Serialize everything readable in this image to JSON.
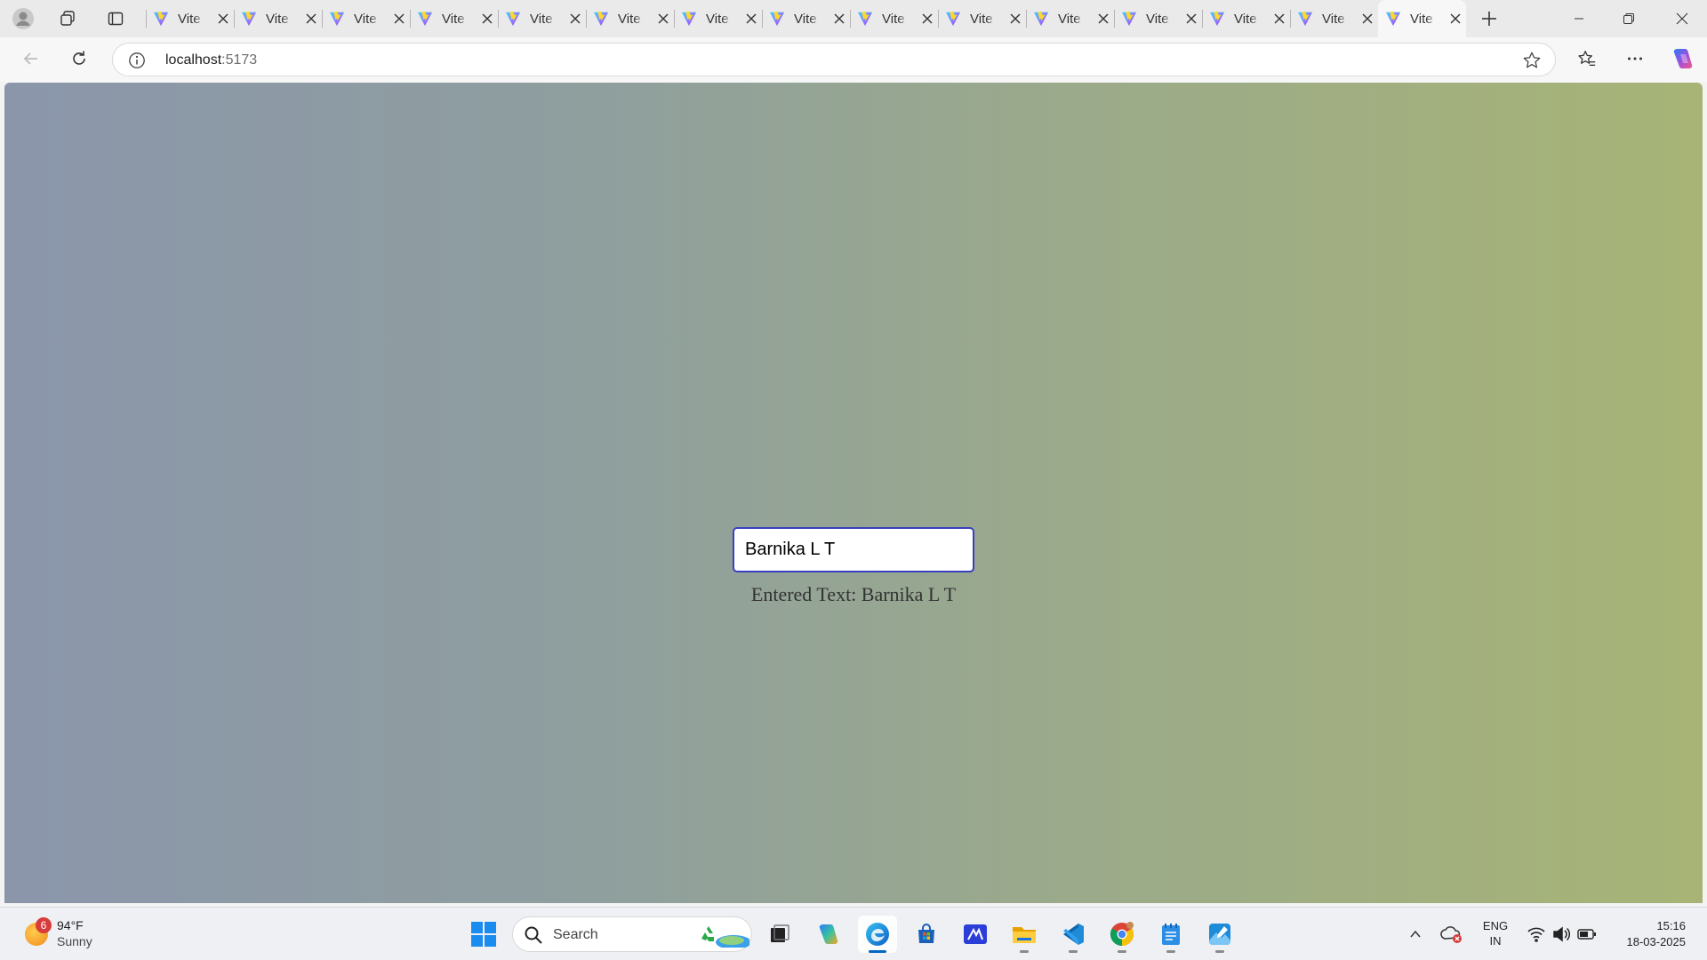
{
  "browser": {
    "tabs": [
      {
        "title": "Vite"
      },
      {
        "title": "Vite"
      },
      {
        "title": "Vite"
      },
      {
        "title": "Vite"
      },
      {
        "title": "Vite"
      },
      {
        "title": "Vite"
      },
      {
        "title": "Vite"
      },
      {
        "title": "Vite"
      },
      {
        "title": "Vite"
      },
      {
        "title": "Vite"
      },
      {
        "title": "Vite"
      },
      {
        "title": "Vite"
      },
      {
        "title": "Vite"
      },
      {
        "title": "Vite"
      },
      {
        "title": "Vite",
        "active": true
      }
    ],
    "address": {
      "host": "localhost",
      "port": ":5173"
    },
    "accent_color": "#0067c0"
  },
  "page": {
    "input_value": "Barnika L T",
    "output_text": "Entered Text: Barnika L T",
    "input_border_color": "#3a3fbf"
  },
  "taskbar": {
    "weather": {
      "badge": "6",
      "temp": "94°F",
      "desc": "Sunny"
    },
    "search_placeholder": "Search",
    "apps": [
      "windows-start-icon",
      "task-view-icon",
      "copilot-icon",
      "edge-icon",
      "store-icon",
      "whiteboard-icon",
      "file-explorer-icon",
      "vscode-icon",
      "chrome-icon",
      "notepad-icon",
      "photos-icon"
    ],
    "lang": {
      "line1": "ENG",
      "line2": "IN"
    },
    "clock": {
      "time": "15:16",
      "date": "18-03-2025"
    }
  }
}
